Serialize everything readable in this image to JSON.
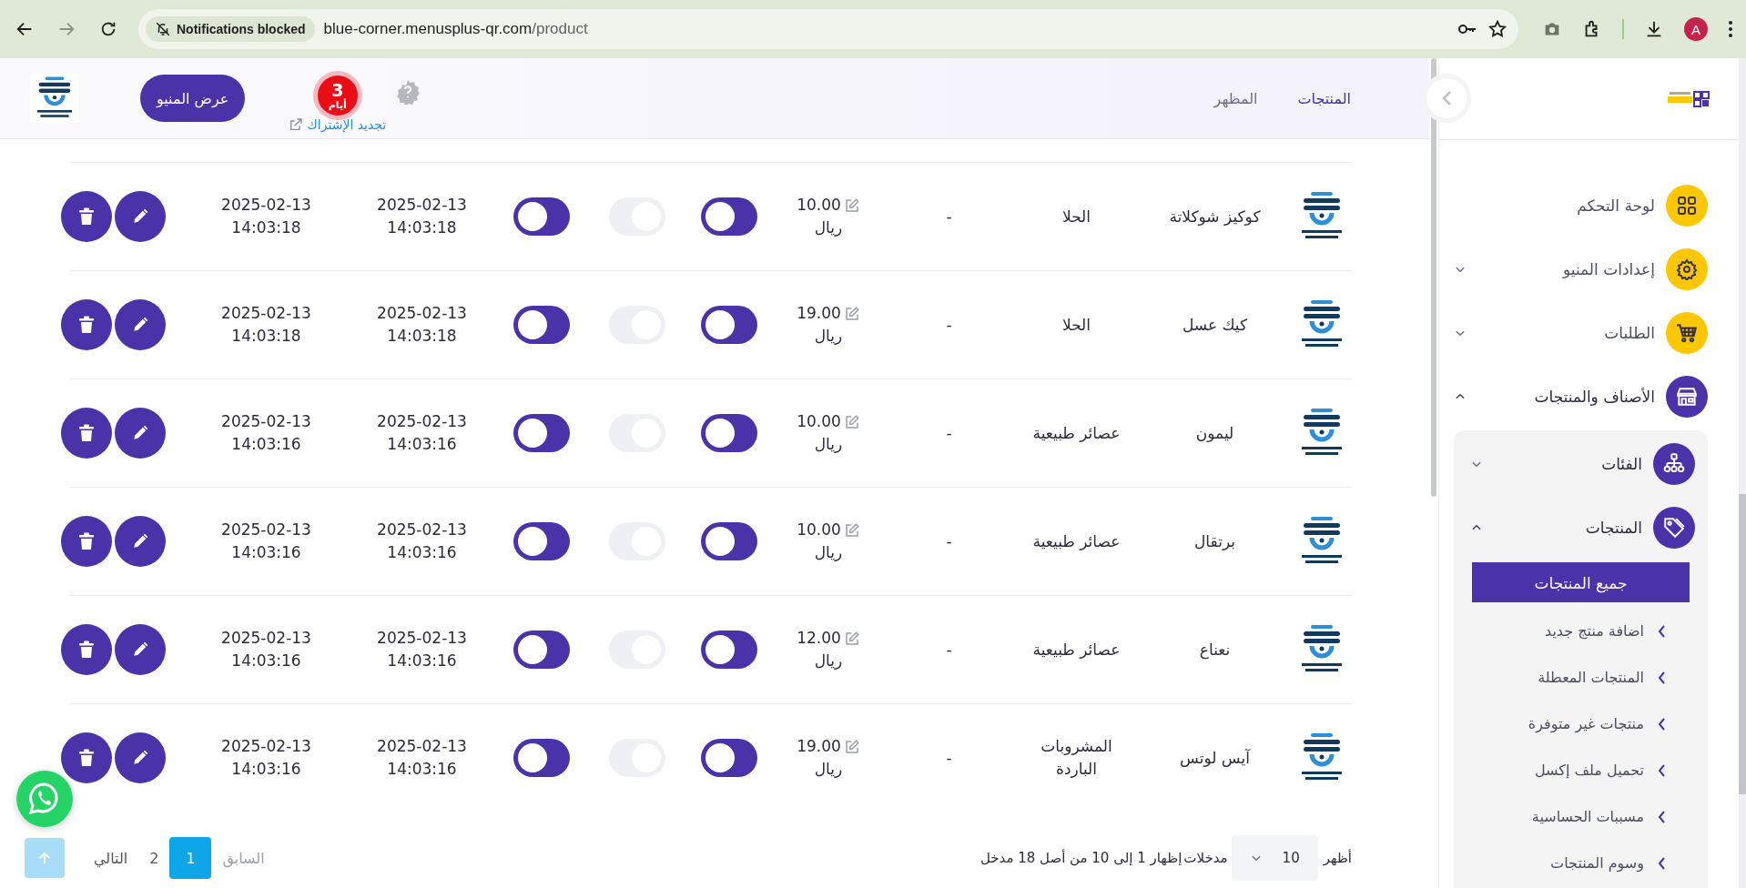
{
  "browser": {
    "notice": "Notifications blocked",
    "url_host": "blue-corner.menusplus-qr.com",
    "url_path": "/product",
    "profile_initial": "A"
  },
  "header": {
    "nav": [
      {
        "label": "المنتجات",
        "selected": true
      },
      {
        "label": "المظهر",
        "selected": false
      }
    ],
    "days_count": "3",
    "days_label": "أيام",
    "renew_link": "تجديد الإشتراك",
    "view_menu_button": "عرض المنيو"
  },
  "sidebar": {
    "items": [
      {
        "label": "لوحة التحكم",
        "color": "#ffc700"
      },
      {
        "label": "إعدادات المنيو",
        "color": "#ffc700",
        "expanded": false
      },
      {
        "label": "الطلبات",
        "color": "#ffc700",
        "expanded": false
      },
      {
        "label": "الأصناف والمنتجات",
        "color": "#4a32a8",
        "expanded": true,
        "children": [
          {
            "label": "الفئات",
            "color": "#4a32a8",
            "expanded": false
          },
          {
            "label": "المنتجات",
            "color": "#4a32a8",
            "expanded": true,
            "children": [
              {
                "label": "جميع المنتجات",
                "selected": true
              },
              {
                "label": "اضافة منتج جديد",
                "selected": false
              },
              {
                "label": "المنتجات المعطلة",
                "selected": false
              },
              {
                "label": "منتجات غير متوفرة",
                "selected": false
              },
              {
                "label": "تحميل ملف إكسل",
                "selected": false
              },
              {
                "label": "مسببات الحساسية",
                "selected": false
              },
              {
                "label": "وسوم المنتجات",
                "selected": false
              }
            ]
          }
        ]
      }
    ]
  },
  "table": {
    "rows": [
      {
        "name": "كوكيز شوكلاتة",
        "category": "الحلا",
        "column_4": "-",
        "price": "10.00",
        "currency": "ريال",
        "switches": [
          {
            "on": true
          },
          {
            "on": false
          },
          {
            "on": true
          }
        ],
        "date_1": "2025-02-13",
        "time_1": "14:03:18",
        "date_2": "2025-02-13",
        "time_2": "14:03:18"
      },
      {
        "name": "كيك عسل",
        "category": "الحلا",
        "column_4": "-",
        "price": "19.00",
        "currency": "ريال",
        "switches": [
          {
            "on": true
          },
          {
            "on": false
          },
          {
            "on": true
          }
        ],
        "date_1": "2025-02-13",
        "time_1": "14:03:18",
        "date_2": "2025-02-13",
        "time_2": "14:03:18"
      },
      {
        "name": "ليمون",
        "category": "عصائر طبيعية",
        "column_4": "-",
        "price": "10.00",
        "currency": "ريال",
        "switches": [
          {
            "on": true
          },
          {
            "on": false
          },
          {
            "on": true
          }
        ],
        "date_1": "2025-02-13",
        "time_1": "14:03:16",
        "date_2": "2025-02-13",
        "time_2": "14:03:16"
      },
      {
        "name": "برتقال",
        "category": "عصائر طبيعية",
        "column_4": "-",
        "price": "10.00",
        "currency": "ريال",
        "switches": [
          {
            "on": true
          },
          {
            "on": false
          },
          {
            "on": true
          }
        ],
        "date_1": "2025-02-13",
        "time_1": "14:03:16",
        "date_2": "2025-02-13",
        "time_2": "14:03:16"
      },
      {
        "name": "نعناع",
        "category": "عصائر طبيعية",
        "column_4": "-",
        "price": "12.00",
        "currency": "ريال",
        "switches": [
          {
            "on": true
          },
          {
            "on": false
          },
          {
            "on": true
          }
        ],
        "date_1": "2025-02-13",
        "time_1": "14:03:16",
        "date_2": "2025-02-13",
        "time_2": "14:03:16"
      },
      {
        "name": "آيس لوتس",
        "category": "المشروبات الباردة",
        "column_4": "-",
        "price": "19.00",
        "currency": "ريال",
        "switches": [
          {
            "on": true
          },
          {
            "on": false
          },
          {
            "on": true
          }
        ],
        "date_1": "2025-02-13",
        "time_1": "14:03:16",
        "date_2": "2025-02-13",
        "time_2": "14:03:16"
      }
    ]
  },
  "pagination": {
    "show_label": "أظهر",
    "page_size": "10",
    "entries_label": "مدخلات",
    "info": "إظهار 1 إلى 10 من أصل 18 مدخل",
    "previous": "السابق",
    "previous_disabled": true,
    "pages": [
      {
        "label": "1",
        "selected": true
      },
      {
        "label": "2",
        "selected": false
      }
    ],
    "next": "التالي"
  }
}
